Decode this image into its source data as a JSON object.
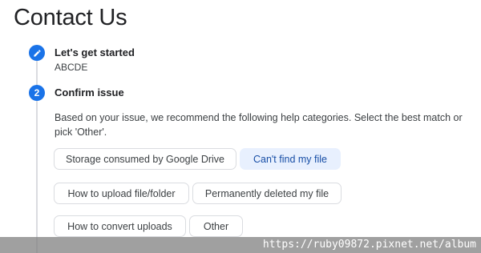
{
  "page": {
    "title": "Contact Us"
  },
  "steps": [
    {
      "number": "",
      "icon": "pencil-icon",
      "title": "Let's get started",
      "value": "ABCDE"
    },
    {
      "number": "2",
      "title": "Confirm issue"
    }
  ],
  "confirm_issue": {
    "description": "Based on your issue, we recommend the following help categories. Select the best match or pick 'Other'.",
    "categories": [
      {
        "label": "Storage consumed by Google Drive",
        "selected": false
      },
      {
        "label": "Can't find my file",
        "selected": true
      },
      {
        "label": "How to upload file/folder",
        "selected": false
      },
      {
        "label": "Permanently deleted my file",
        "selected": false
      },
      {
        "label": "How to convert uploads",
        "selected": false
      },
      {
        "label": "Other",
        "selected": false
      }
    ]
  },
  "watermark": {
    "text": "https://ruby09872.pixnet.net/album"
  },
  "colors": {
    "accent": "#1a73e8",
    "selected_chip_bg": "#e8f0fe",
    "rail": "#dadce0"
  }
}
